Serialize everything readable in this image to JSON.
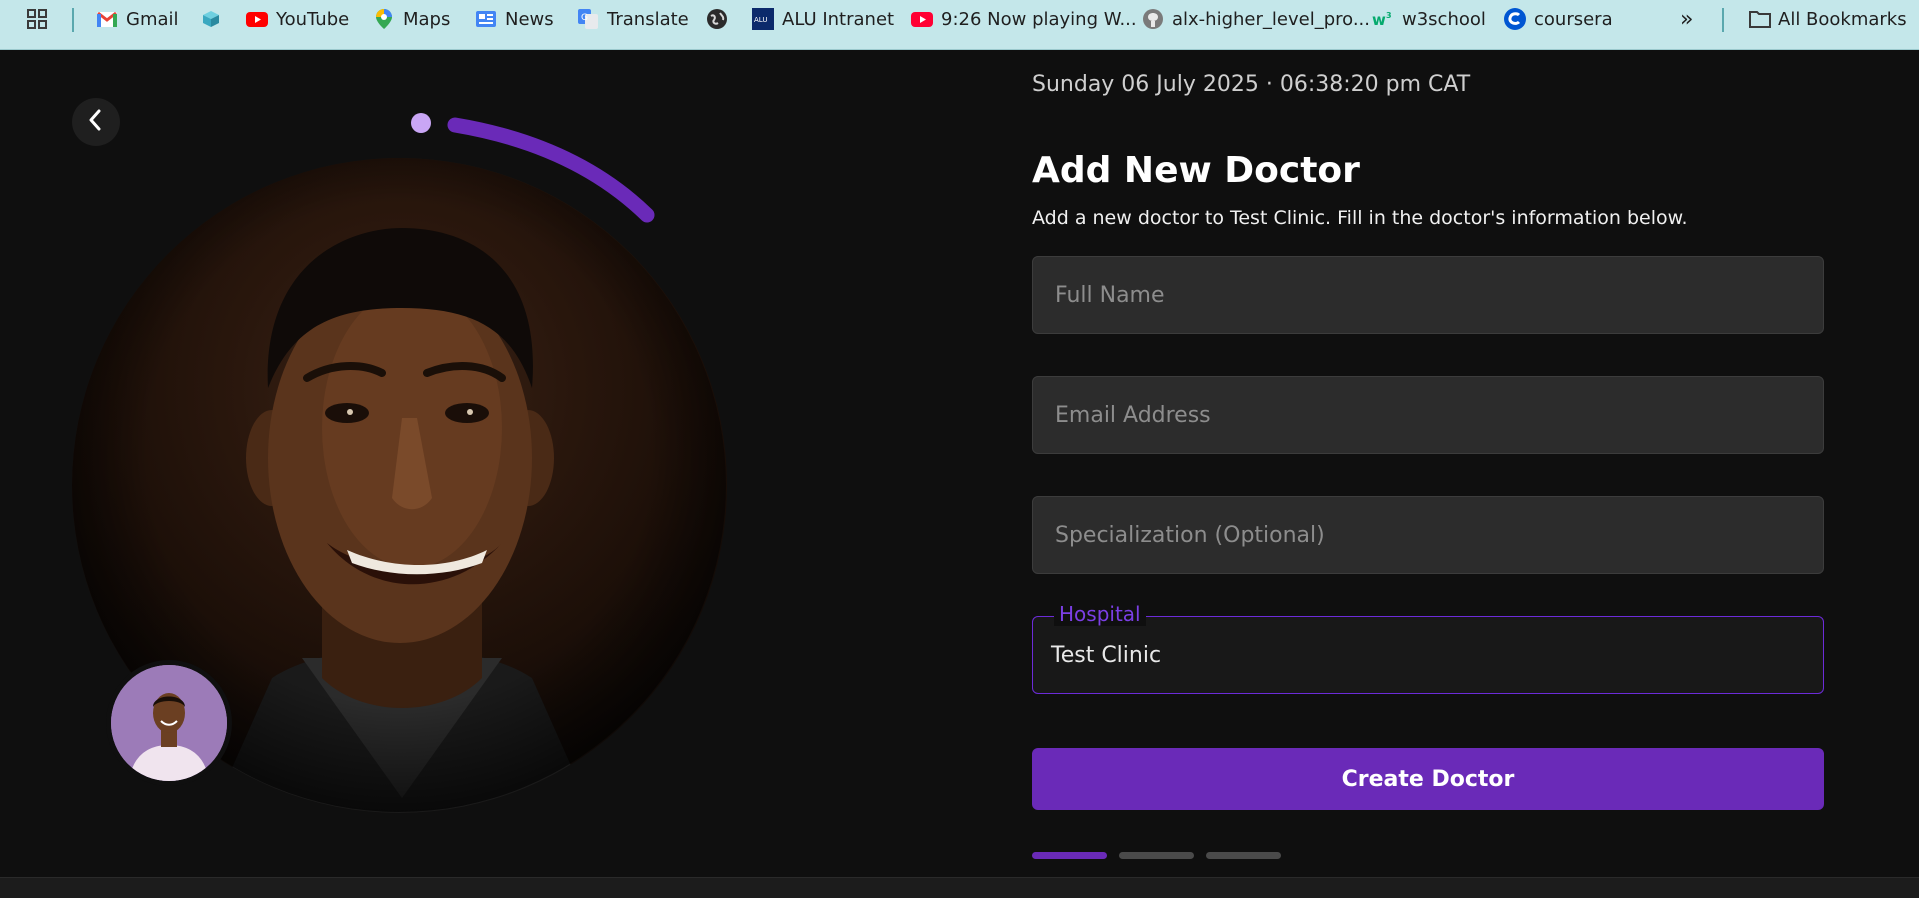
{
  "bookmarks_bar": {
    "items": [
      {
        "label": "",
        "icon": "apps-grid-icon"
      },
      {
        "label": "Gmail",
        "icon": "gmail-icon"
      },
      {
        "label": "",
        "icon": "box-icon"
      },
      {
        "label": "YouTube",
        "icon": "youtube-icon"
      },
      {
        "label": "Maps",
        "icon": "maps-pin-icon"
      },
      {
        "label": "News",
        "icon": "news-icon"
      },
      {
        "label": "Translate",
        "icon": "translate-icon"
      },
      {
        "label": "",
        "icon": "globe-icon"
      },
      {
        "label": "ALU Intranet",
        "icon": "alu-icon"
      },
      {
        "label": "9:26 Now playing W...",
        "icon": "youtube-icon"
      },
      {
        "label": "alx-higher_level_pro...",
        "icon": "github-icon"
      },
      {
        "label": "w3school",
        "icon": "w3-icon"
      },
      {
        "label": "coursera",
        "icon": "coursera-icon"
      }
    ],
    "overflow": "»",
    "all_bookmarks": "All Bookmarks"
  },
  "page": {
    "datetime": "Sunday 06 July 2025 · 06:38:20 pm CAT",
    "title": "Add New Doctor",
    "subtitle": "Add a new doctor to Test Clinic. Fill in the doctor's information below.",
    "fields": {
      "full_name_placeholder": "Full Name",
      "email_placeholder": "Email Address",
      "specialization_placeholder": "Specialization (Optional)",
      "hospital_label": "Hospital",
      "hospital_value": "Test Clinic"
    },
    "submit_label": "Create Doctor",
    "steps": {
      "total": 3,
      "current": 1
    }
  },
  "colors": {
    "accent": "#6a2ab8",
    "accent_light": "#c9a6f5",
    "bookmarks_bg": "#c4e7ea",
    "page_bg": "#0f0f0f",
    "input_bg": "#2c2c2c"
  }
}
